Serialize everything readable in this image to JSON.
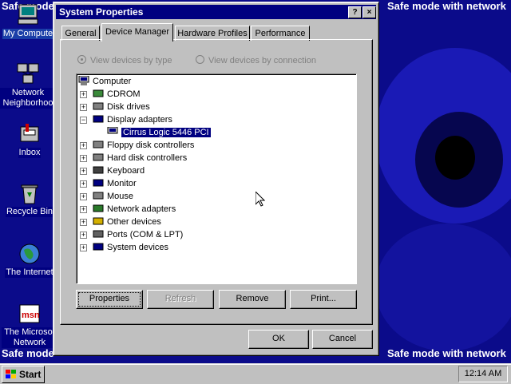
{
  "desktop": {
    "safe_mode_text": "Safe mode",
    "safe_mode_full": "Safe mode with network",
    "icons": [
      {
        "label": "My Compute"
      },
      {
        "label": "Network Neighborhoo"
      },
      {
        "label": "Inbox"
      },
      {
        "label": "Recycle Bin"
      },
      {
        "label": "The Internet"
      },
      {
        "label": "The Microsof Network"
      }
    ]
  },
  "window": {
    "title": "System Properties",
    "help_btn": "?",
    "close_btn": "×",
    "tabs": [
      "General",
      "Device Manager",
      "Hardware Profiles",
      "Performance"
    ],
    "active_tab": "Device Manager",
    "radio_by_type": "View devices by type",
    "radio_by_connection": "View devices by connection",
    "tree": {
      "root": "Computer",
      "items": [
        {
          "label": "CDROM",
          "expanded": false
        },
        {
          "label": "Disk drives",
          "expanded": false
        },
        {
          "label": "Display adapters",
          "expanded": true,
          "child": "Cirrus Logic 5446 PCI"
        },
        {
          "label": "Floppy disk controllers",
          "expanded": false
        },
        {
          "label": "Hard disk controllers",
          "expanded": false
        },
        {
          "label": "Keyboard",
          "expanded": false
        },
        {
          "label": "Monitor",
          "expanded": false
        },
        {
          "label": "Mouse",
          "expanded": false
        },
        {
          "label": "Network adapters",
          "expanded": false
        },
        {
          "label": "Other devices",
          "expanded": false
        },
        {
          "label": "Ports (COM & LPT)",
          "expanded": false
        },
        {
          "label": "System devices",
          "expanded": false
        }
      ],
      "selected": "Cirrus Logic 5446 PCI"
    },
    "buttons": {
      "properties": "Properties",
      "refresh": "Refresh",
      "remove": "Remove",
      "print": "Print...",
      "ok": "OK",
      "cancel": "Cancel"
    }
  },
  "taskbar": {
    "start": "Start",
    "clock": "12:14 AM"
  },
  "colors": {
    "desktop": "#0b0b8a",
    "titlebar": "#000080",
    "face": "#c0c0c0",
    "selection": "#000080"
  }
}
